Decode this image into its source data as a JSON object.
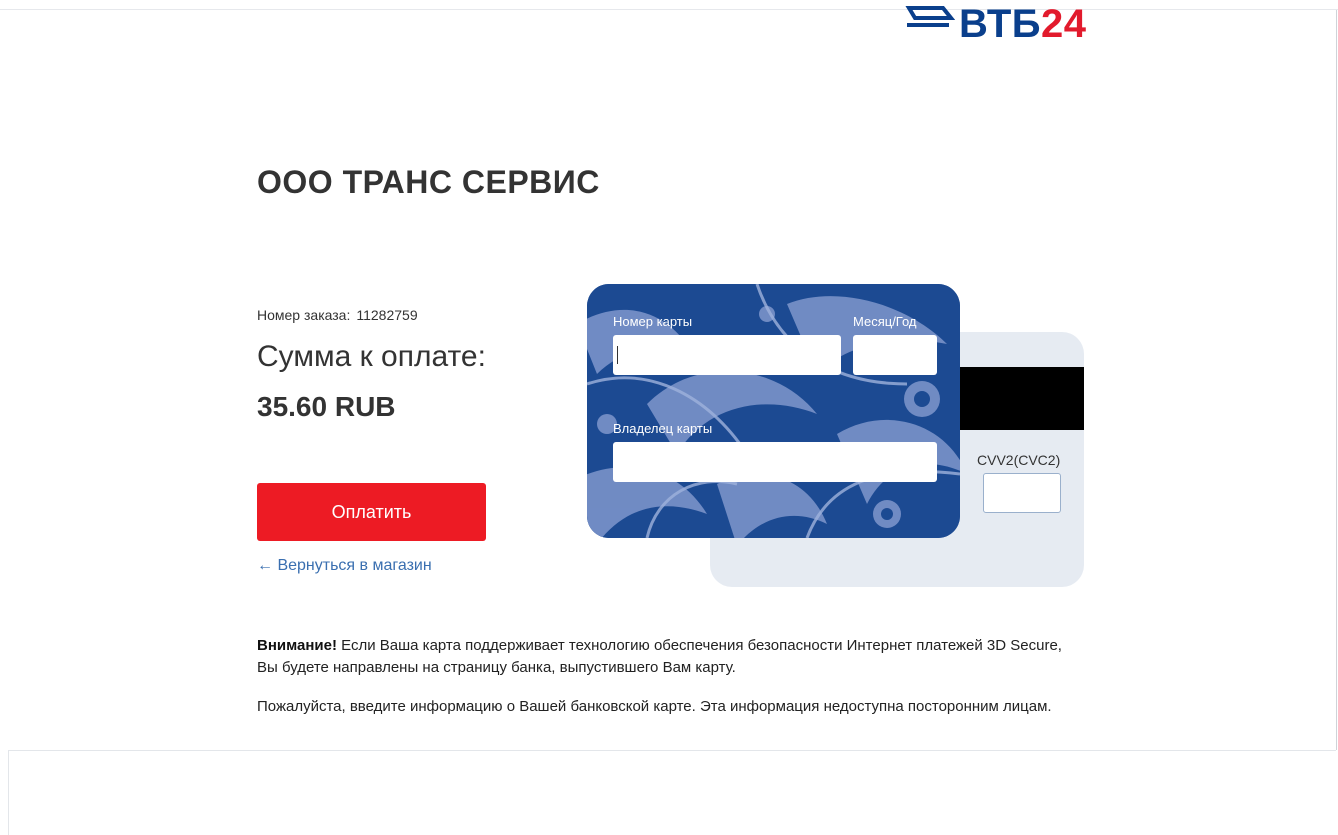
{
  "brand": {
    "logo_text_main": "ВТБ",
    "logo_text_num": "24",
    "colors": {
      "blue": "#0a3f8c",
      "red": "#e21a2c"
    }
  },
  "merchant": {
    "name": "ООО ТРАНС СЕРВИС"
  },
  "order": {
    "label": "Номер заказа:",
    "number": "11282759",
    "sum_label": "Сумма к оплате:",
    "amount": "35.60 RUB"
  },
  "actions": {
    "pay_label": "Оплатить",
    "pay_color": "#ed1b24",
    "back_label": "← Вернуться в магазин"
  },
  "card": {
    "number_label": "Номер карты",
    "number_value": "",
    "expiry_label": "Месяц/Год",
    "expiry_value": "",
    "holder_label": "Владелец карты",
    "holder_value": "",
    "cvv_label": "CVV2(CVC2)",
    "cvv_value": "",
    "front_color": "#1c4a92",
    "back_color": "#e6ebf2"
  },
  "notes": {
    "warning_bold": "Внимание!",
    "warning_text": " Если Ваша карта поддерживает технологию обеспечения безопасности Интернет платежей 3D Secure, Вы будете направлены на страницу банка, выпустившего Вам карту.",
    "info_text": "Пожалуйста, введите информацию о Вашей банковской карте. Эта информация недоступна посторонним лицам."
  }
}
